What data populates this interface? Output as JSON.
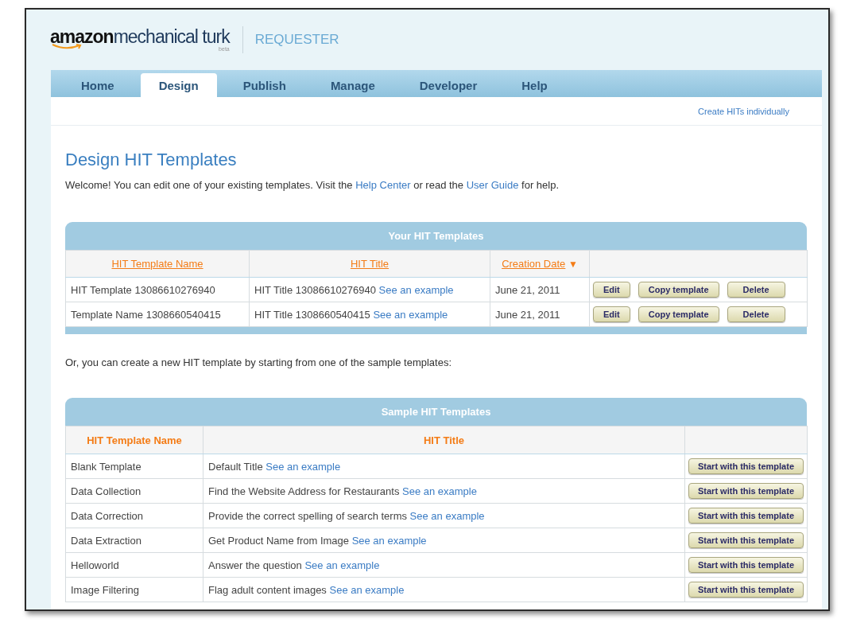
{
  "header": {
    "logo_brand": "amazon",
    "logo_product": "mechanical turk",
    "logo_badge": "beta",
    "section": "REQUESTER"
  },
  "tabs": [
    {
      "label": "Home",
      "selected": false
    },
    {
      "label": "Design",
      "selected": true
    },
    {
      "label": "Publish",
      "selected": false
    },
    {
      "label": "Manage",
      "selected": false
    },
    {
      "label": "Developer",
      "selected": false
    },
    {
      "label": "Help",
      "selected": false
    }
  ],
  "top_link": "Create HITs individually",
  "page_title": "Design HIT Templates",
  "intro": [
    {
      "kind": "text",
      "text": "Welcome! You can edit one of your existing templates. Visit the "
    },
    {
      "kind": "link",
      "text": "Help Center"
    },
    {
      "kind": "text",
      "text": " or read the "
    },
    {
      "kind": "link",
      "text": "User Guide"
    },
    {
      "kind": "text",
      "text": " for help."
    }
  ],
  "your_templates": {
    "title": "Your HIT Templates",
    "columns": [
      {
        "label": "HIT Template Name",
        "sortable": true
      },
      {
        "label": "HIT Title",
        "sortable": true
      },
      {
        "label": "Creation Date",
        "sortable": true,
        "sort_mark": "▼"
      }
    ],
    "rows": [
      {
        "name": "HIT Template 13086610276940",
        "title": "HIT Title 13086610276940",
        "link": "See an example",
        "date": "June 21, 2011",
        "actions": [
          "Edit",
          "Copy template",
          "Delete"
        ]
      },
      {
        "name": "Template Name 1308660540415",
        "title": "HIT Title 1308660540415",
        "link": "See an example",
        "date": "June 21, 2011",
        "actions": [
          "Edit",
          "Copy template",
          "Delete"
        ]
      }
    ]
  },
  "alt_text": "Or, you can create a new HIT template by starting from one of the sample templates:",
  "sample_templates": {
    "title": "Sample HIT Templates",
    "columns": [
      {
        "label": "HIT Template Name",
        "sortable": false
      },
      {
        "label": "HIT Title",
        "sortable": false
      }
    ],
    "rows": [
      {
        "name": "Blank Template",
        "title": "Default Title",
        "link": "See an example",
        "action": "Start with this template"
      },
      {
        "name": "Data Collection",
        "title": "Find the Website Address for Restaurants",
        "link": "See an example",
        "action": "Start with this template"
      },
      {
        "name": "Data Correction",
        "title": "Provide the correct spelling of search terms",
        "link": "See an example",
        "action": "Start with this template"
      },
      {
        "name": "Data Extraction",
        "title": "Get Product Name from Image",
        "link": "See an example",
        "action": "Start with this template"
      },
      {
        "name": "Helloworld",
        "title": "Answer the question",
        "link": "See an example",
        "action": "Start with this template"
      },
      {
        "name": "Image Filtering",
        "title": "Flag adult content images",
        "link": "See an example",
        "action": "Start with this template"
      }
    ]
  }
}
